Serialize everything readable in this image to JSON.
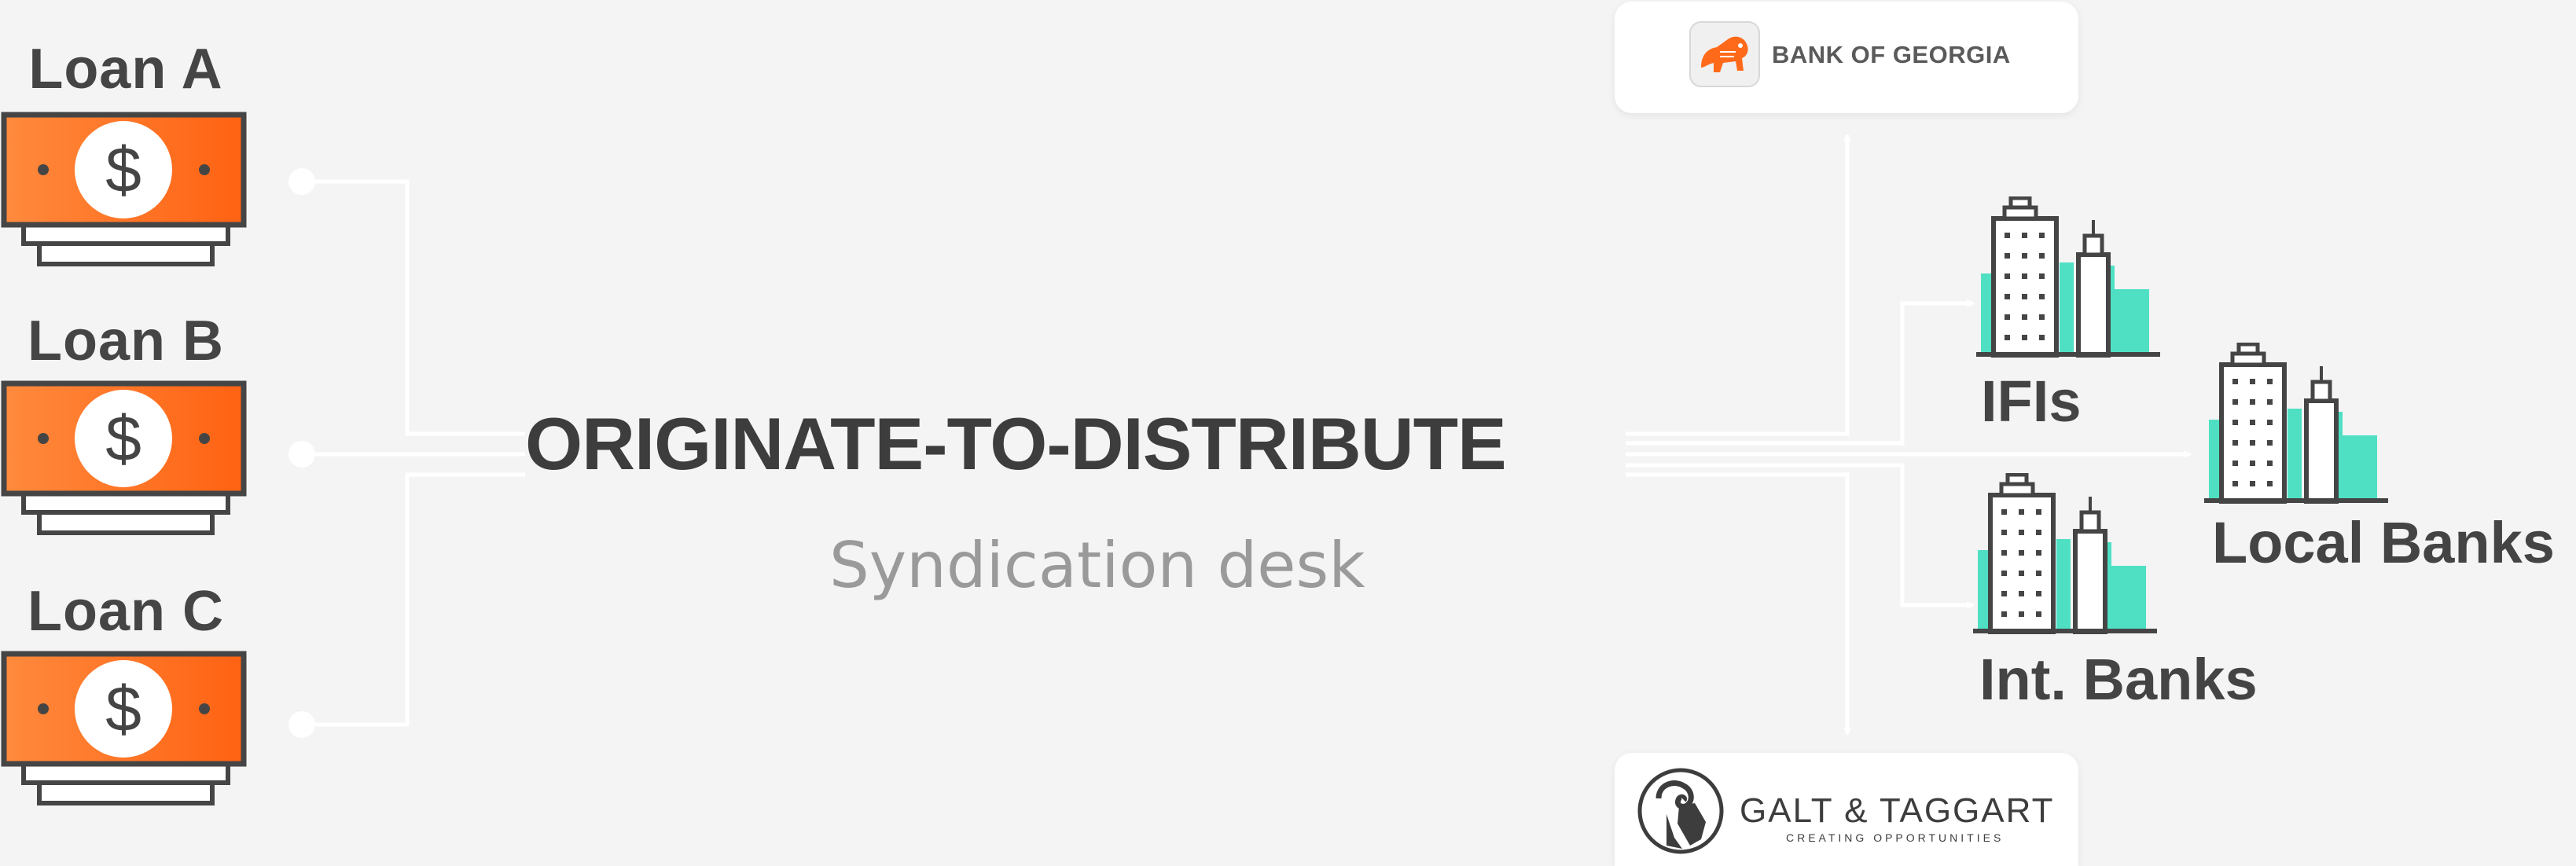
{
  "loans": [
    {
      "label": "Loan A",
      "icon": "dollar-bill-icon"
    },
    {
      "label": "Loan B",
      "icon": "dollar-bill-icon"
    },
    {
      "label": "Loan C",
      "icon": "dollar-bill-icon"
    }
  ],
  "center": {
    "title": "ORIGINATE-TO-DISTRIBUTE",
    "subtitle": "Syndication desk"
  },
  "destinations": {
    "bank_of_georgia": {
      "name": "BANK OF GEORGIA",
      "icon": "lion-logo-icon"
    },
    "ifis": {
      "label": "IFIs",
      "icon": "city-buildings-icon"
    },
    "local_banks": {
      "label": "Local Banks",
      "icon": "city-buildings-icon"
    },
    "int_banks": {
      "label": "Int. Banks",
      "icon": "city-buildings-icon"
    },
    "galt_taggart": {
      "name": "GALT & TAGGART",
      "tagline": "CREATING OPPORTUNITIES",
      "icon": "ram-logo-icon"
    }
  },
  "colors": {
    "background": "#f4f4f4",
    "bill_orange": "#ff6a1a",
    "bill_orange_light": "#ff8a3d",
    "dark_gray": "#454545",
    "teal": "#4fe0c4",
    "connector": "#ffffff",
    "subtitle_gray": "#9a9a9a"
  }
}
